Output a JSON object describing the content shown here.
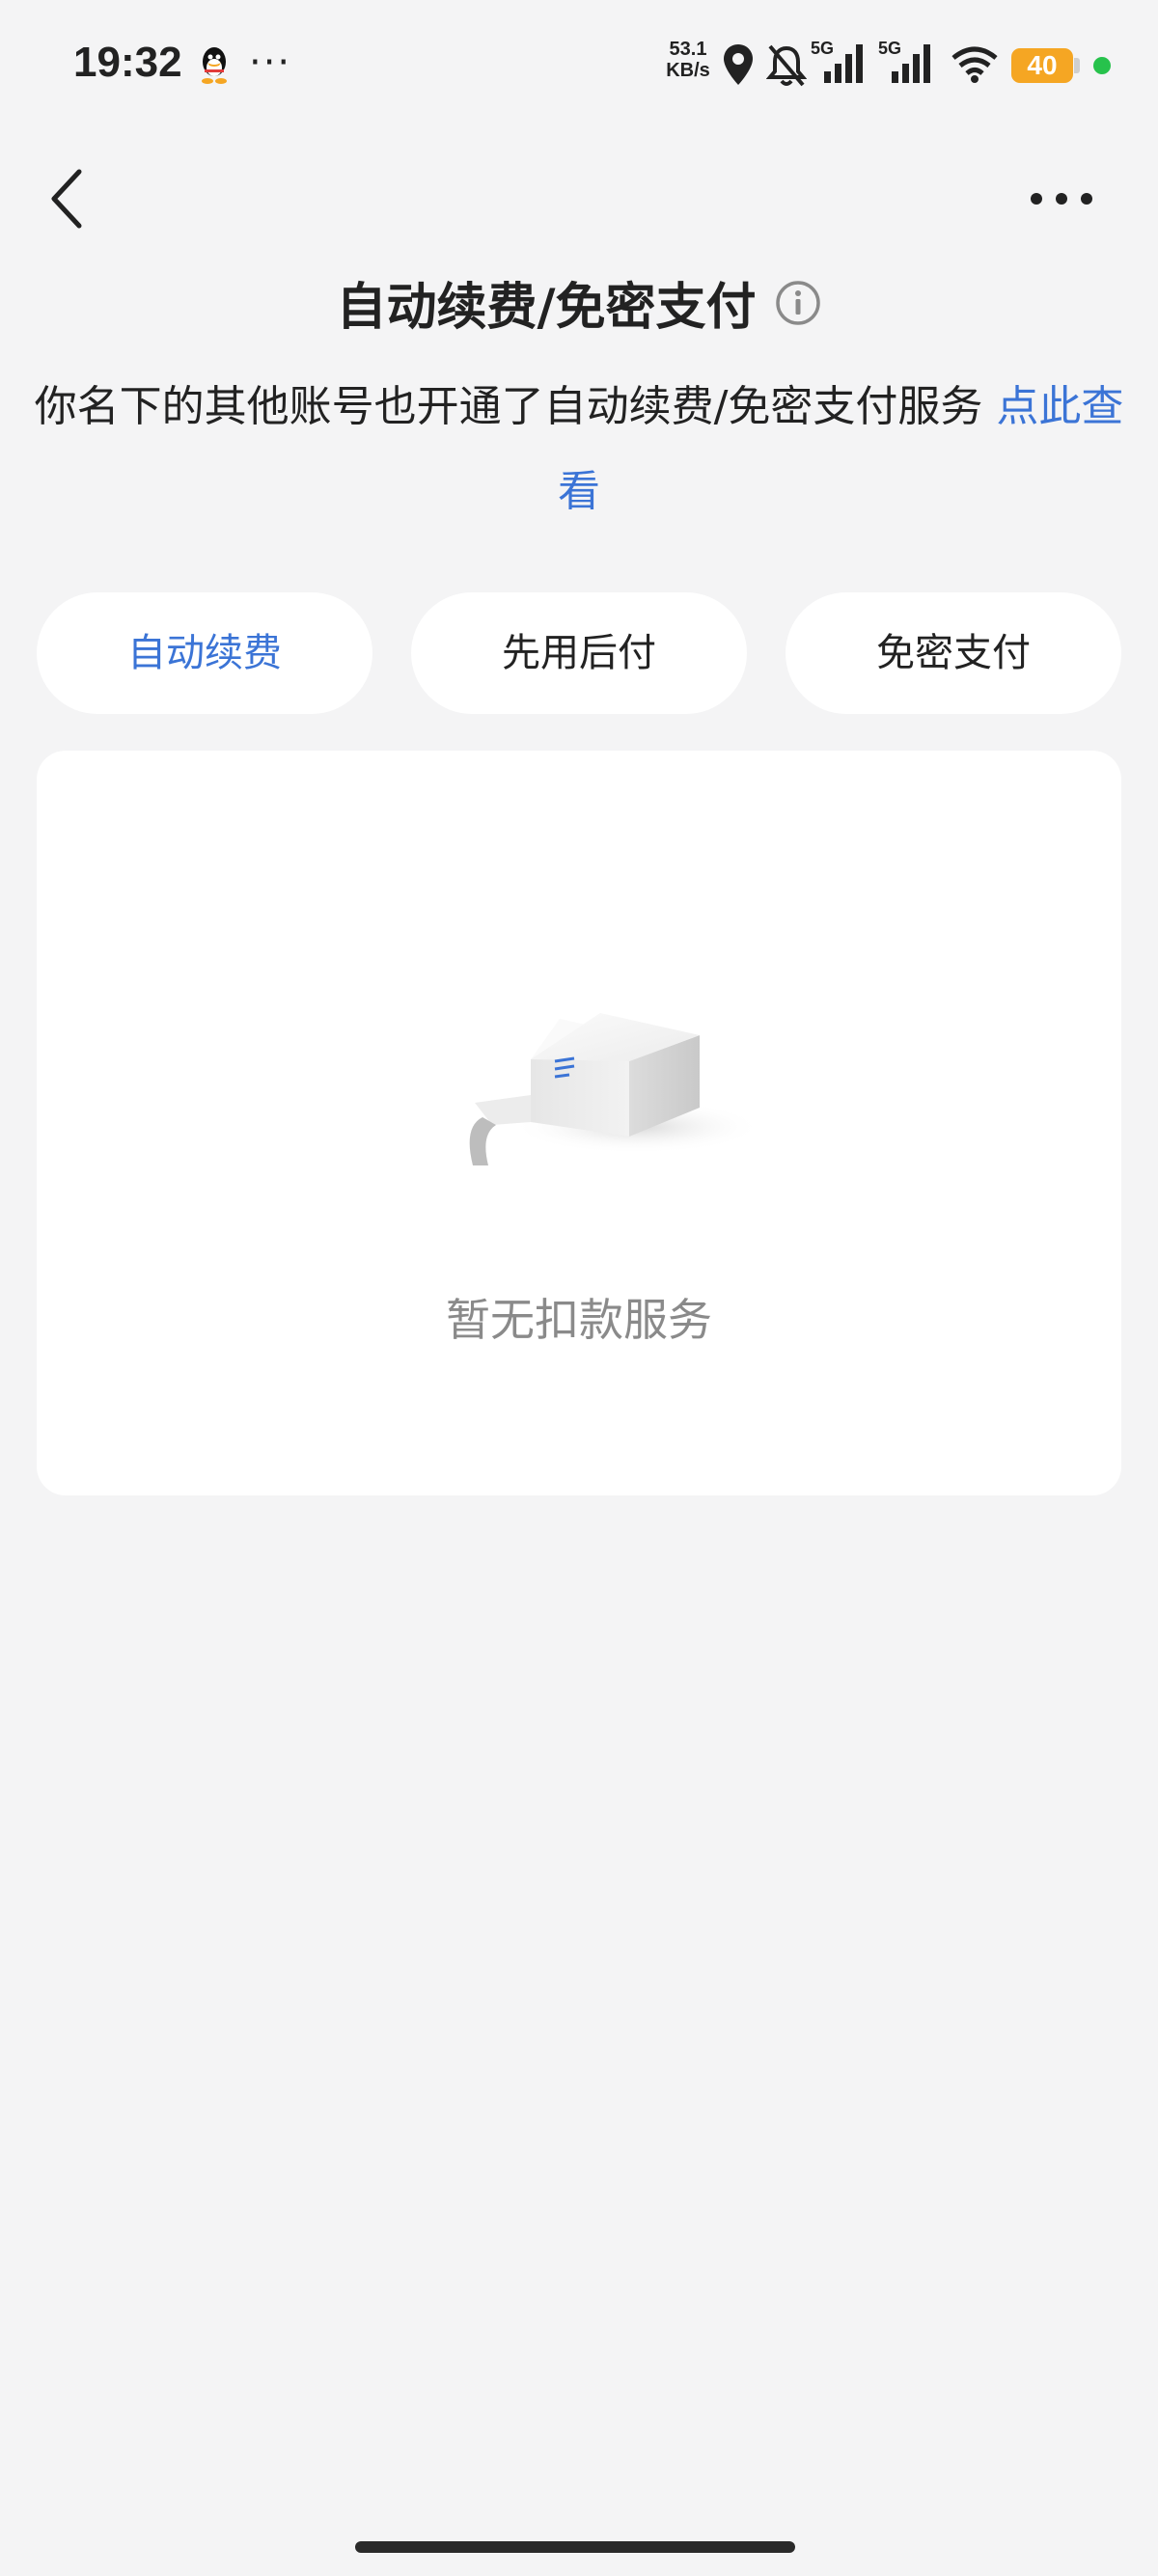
{
  "status_bar": {
    "time": "19:32",
    "more": "···",
    "net_speed_value": "53.1",
    "net_speed_unit": "KB/s",
    "signal_1_label": "5G",
    "signal_2_label": "5G",
    "battery_level": "40",
    "icons": [
      "qq-icon",
      "location-icon",
      "mute-bell-icon",
      "signal-icon",
      "signal-icon",
      "wifi-icon",
      "battery-icon"
    ]
  },
  "header": {
    "title": "自动续费/免密支付",
    "info_icon": "info-icon",
    "back_icon": "chevron-left-icon",
    "more_icon": "more-icon"
  },
  "notice": {
    "text": "你名下的其他账号也开通了自动续费/免密支付服务 ",
    "link": "点此查看"
  },
  "tabs": [
    {
      "label": "自动续费",
      "active": true
    },
    {
      "label": "先用后付",
      "active": false
    },
    {
      "label": "免密支付",
      "active": false
    }
  ],
  "empty_state": {
    "message": "暂无扣款服务",
    "illustration": "empty-box-illustration"
  },
  "colors": {
    "accent": "#3b74d6",
    "background": "#f4f4f5",
    "card": "#ffffff",
    "battery": "#f5a623",
    "status_dot": "#27c24c"
  }
}
